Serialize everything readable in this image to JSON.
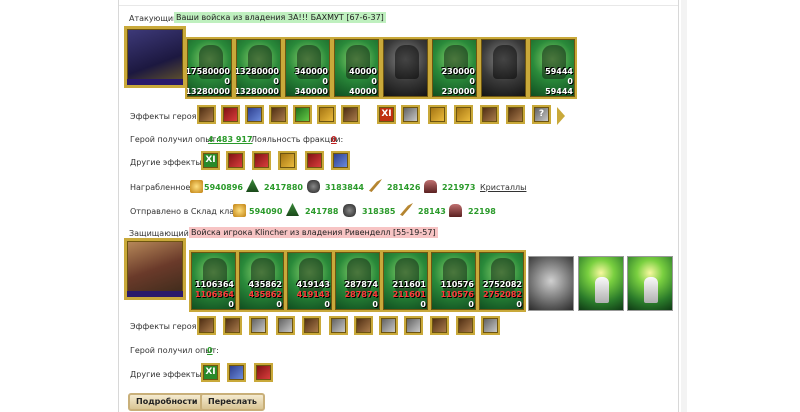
{
  "attacker": {
    "label": "Атакующий",
    "owner": "Ваши войска из владения ЗА!!! БАХМУТ [67-6-37]",
    "units": [
      {
        "n1": "17580000",
        "n2": "0",
        "n3": "13280000"
      },
      {
        "n1": "13280000",
        "n2": "0",
        "n3": "13280000"
      },
      {
        "n1": "340000",
        "n2": "0",
        "n3": "340000"
      },
      {
        "n1": "40000",
        "n2": "0",
        "n3": "40000"
      },
      {
        "n1": "",
        "n2": "",
        "n3": ""
      },
      {
        "n1": "230000",
        "n2": "0",
        "n3": "230000"
      },
      {
        "n1": "",
        "n2": "",
        "n3": ""
      },
      {
        "n1": "59444",
        "n2": "0",
        "n3": "59444"
      }
    ],
    "hero_effects_label": "Эффекты героя:",
    "exp_label": "Герой получил опыт:",
    "exp_value": "4 483 917",
    "loyalty_label": "Лояльность фракции:",
    "loyalty_value": "0",
    "other_effects_label": "Другие эффекты:"
  },
  "loot": {
    "label": "Награбленное",
    "gold": "5940896",
    "wood": "2417880",
    "ore": "3183844",
    "feathers": "281426",
    "crystals": "221973",
    "crystals_link": "Кристаллы"
  },
  "clan": {
    "label": "Отправлено в Склад клана",
    "gold": "594090",
    "wood": "241788",
    "ore": "318385",
    "feathers": "28143",
    "crystals": "22198"
  },
  "defender": {
    "label": "Защищающийся",
    "owner": "Войска игрока Klincher из владения Ривенделл [55-19-57]",
    "units": [
      {
        "n1": "1106364",
        "n2": "1106364",
        "n3": "0"
      },
      {
        "n1": "435862",
        "n2": "435862",
        "n3": "0"
      },
      {
        "n1": "419143",
        "n2": "419143",
        "n3": "0"
      },
      {
        "n1": "287874",
        "n2": "287874",
        "n3": "0"
      },
      {
        "n1": "211601",
        "n2": "211601",
        "n3": "0"
      },
      {
        "n1": "110576",
        "n2": "110576",
        "n3": "0"
      },
      {
        "n1": "2752082",
        "n2": "2752082",
        "n3": "0"
      }
    ],
    "hero_effects_label": "Эффекты героя:",
    "exp_label": "Герой получил опыт:",
    "exp_value": "0",
    "other_effects_label": "Другие эффекты:"
  },
  "buttons": {
    "details": "Подробности",
    "forward": "Переслать"
  },
  "icons": {
    "xi_label": "XI",
    "xi_label_red": "XI",
    "question": "?"
  }
}
